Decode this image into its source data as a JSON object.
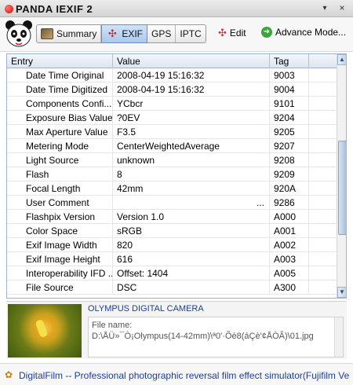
{
  "window": {
    "title": "PANDA IEXIF 2",
    "minimize_label": "▾",
    "close_label": "×"
  },
  "toolbar": {
    "tabs": [
      {
        "label": "Summary",
        "icon": "photo-icon"
      },
      {
        "label": "EXIF",
        "icon": "exif-icon"
      },
      {
        "label": "GPS"
      },
      {
        "label": "IPTC"
      }
    ],
    "active_tab": "EXIF",
    "edit_label": "Edit",
    "advanced_label": "Advance Mode..."
  },
  "table": {
    "columns": [
      "Entry",
      "Value",
      "Tag"
    ],
    "rows": [
      {
        "entry": "Date Time Original",
        "value": "2008-04-19 15:16:32",
        "tag": "9003"
      },
      {
        "entry": "Date Time Digitized",
        "value": "2008-04-19 15:16:32",
        "tag": "9004"
      },
      {
        "entry": "Components Confi...",
        "value": "YCbcr",
        "tag": "9101"
      },
      {
        "entry": "Exposure Bias Value",
        "value": "?0EV",
        "tag": "9204"
      },
      {
        "entry": "Max Aperture Value",
        "value": "F3.5",
        "tag": "9205"
      },
      {
        "entry": "Metering Mode",
        "value": "CenterWeightedAverage",
        "tag": "9207"
      },
      {
        "entry": "Light Source",
        "value": "unknown",
        "tag": "9208"
      },
      {
        "entry": "Flash",
        "value": "8",
        "tag": "9209"
      },
      {
        "entry": "Focal Length",
        "value": "42mm",
        "tag": "920A"
      },
      {
        "entry": "User Comment",
        "value": "",
        "value_ellipsis": "...",
        "tag": "9286"
      },
      {
        "entry": "Flashpix Version",
        "value": "Version 1.0",
        "tag": "A000"
      },
      {
        "entry": "Color Space",
        "value": "sRGB",
        "tag": "A001"
      },
      {
        "entry": "Exif Image Width",
        "value": "820",
        "tag": "A002"
      },
      {
        "entry": "Exif Image Height",
        "value": "616",
        "tag": "A003"
      },
      {
        "entry": "Interoperability IFD ...",
        "value": "Offset: 1404",
        "tag": "A005"
      },
      {
        "entry": "File Source",
        "value": "DSC",
        "tag": "A300"
      }
    ]
  },
  "preview": {
    "caption": "OLYMPUS DIGITAL CAMERA",
    "file_name_label": "File name:",
    "file_name_value": "D:\\ÅÜ»¯Ò¡Olympus(14-42mm)\\ª0'·Õè8(áÇè'¢ÅÒÂ)\\01.jpg"
  },
  "status": {
    "text": "DigitalFilm -- Professional photographic reversal film effect simulator(Fujifilm Velvia, Kodak)",
    "icon": "flower-icon"
  }
}
